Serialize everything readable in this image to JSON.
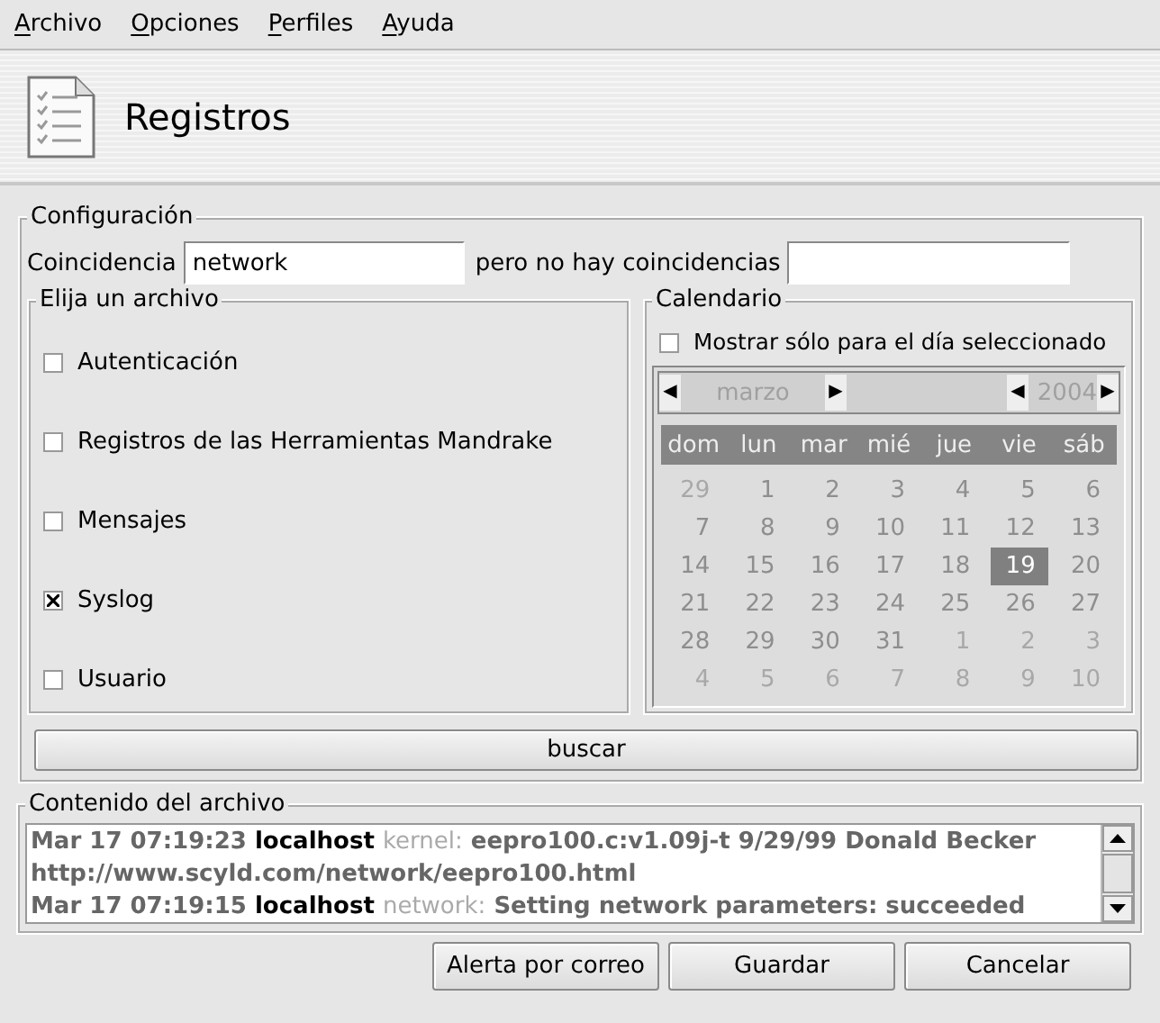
{
  "menu": [
    {
      "label": "Archivo",
      "mnemonic": true
    },
    {
      "label": "Opciones",
      "mnemonic": true
    },
    {
      "label": "Perfiles",
      "mnemonic": true
    },
    {
      "label": "Ayuda",
      "mnemonic": true
    }
  ],
  "header": {
    "title": "Registros"
  },
  "config": {
    "title": "Configuración",
    "match_label": "Coincidencia",
    "match_value": "network",
    "nomatch_label": "pero no hay coincidencias"
  },
  "files": {
    "title": "Elija un archivo",
    "items": [
      {
        "label": "Autenticación",
        "checked": false
      },
      {
        "label": "Registros de las Herramientas Mandrake",
        "checked": false
      },
      {
        "label": "Mensajes",
        "checked": false
      },
      {
        "label": "Syslog",
        "checked": true
      },
      {
        "label": "Usuario",
        "checked": false
      }
    ]
  },
  "calendar": {
    "title": "Calendario",
    "only_selected_day": {
      "label": "Mostrar sólo para el día seleccionado",
      "checked": false
    },
    "disabled": true,
    "month": "marzo",
    "year": "2004",
    "prev": "◀",
    "next": "▶",
    "weekdays": [
      "dom",
      "lun",
      "mar",
      "mié",
      "jue",
      "vie",
      "sáb"
    ],
    "days": [
      {
        "day": "29",
        "current_month": false,
        "selected": false
      },
      {
        "day": "1",
        "current_month": true,
        "selected": false
      },
      {
        "day": "2",
        "current_month": true,
        "selected": false
      },
      {
        "day": "3",
        "current_month": true,
        "selected": false
      },
      {
        "day": "4",
        "current_month": true,
        "selected": false
      },
      {
        "day": "5",
        "current_month": true,
        "selected": false
      },
      {
        "day": "6",
        "current_month": true,
        "selected": false
      },
      {
        "day": "7",
        "current_month": true,
        "selected": false
      },
      {
        "day": "8",
        "current_month": true,
        "selected": false
      },
      {
        "day": "9",
        "current_month": true,
        "selected": false
      },
      {
        "day": "10",
        "current_month": true,
        "selected": false
      },
      {
        "day": "11",
        "current_month": true,
        "selected": false
      },
      {
        "day": "12",
        "current_month": true,
        "selected": false
      },
      {
        "day": "13",
        "current_month": true,
        "selected": false
      },
      {
        "day": "14",
        "current_month": true,
        "selected": false
      },
      {
        "day": "15",
        "current_month": true,
        "selected": false
      },
      {
        "day": "16",
        "current_month": true,
        "selected": false
      },
      {
        "day": "17",
        "current_month": true,
        "selected": false
      },
      {
        "day": "18",
        "current_month": true,
        "selected": false
      },
      {
        "day": "19",
        "current_month": true,
        "selected": true
      },
      {
        "day": "20",
        "current_month": true,
        "selected": false
      },
      {
        "day": "21",
        "current_month": true,
        "selected": false
      },
      {
        "day": "22",
        "current_month": true,
        "selected": false
      },
      {
        "day": "23",
        "current_month": true,
        "selected": false
      },
      {
        "day": "24",
        "current_month": true,
        "selected": false
      },
      {
        "day": "25",
        "current_month": true,
        "selected": false
      },
      {
        "day": "26",
        "current_month": true,
        "selected": false
      },
      {
        "day": "27",
        "current_month": true,
        "selected": false
      },
      {
        "day": "28",
        "current_month": true,
        "selected": false
      },
      {
        "day": "29",
        "current_month": true,
        "selected": false
      },
      {
        "day": "30",
        "current_month": true,
        "selected": false
      },
      {
        "day": "31",
        "current_month": true,
        "selected": false
      },
      {
        "day": "1",
        "current_month": false,
        "selected": false
      },
      {
        "day": "2",
        "current_month": false,
        "selected": false
      },
      {
        "day": "3",
        "current_month": false,
        "selected": false
      },
      {
        "day": "4",
        "current_month": false,
        "selected": false
      },
      {
        "day": "5",
        "current_month": false,
        "selected": false
      },
      {
        "day": "6",
        "current_month": false,
        "selected": false
      },
      {
        "day": "7",
        "current_month": false,
        "selected": false
      },
      {
        "day": "8",
        "current_month": false,
        "selected": false
      },
      {
        "day": "9",
        "current_month": false,
        "selected": false
      },
      {
        "day": "10",
        "current_month": false,
        "selected": false
      }
    ]
  },
  "search_button": "buscar",
  "content": {
    "title": "Contenido del archivo",
    "lines": [
      [
        {
          "kind": "date",
          "text": "Mar 17 07:19:23"
        },
        {
          "kind": "host",
          "text": "localhost"
        },
        {
          "kind": "facility",
          "text": "kernel:"
        },
        {
          "kind": "message",
          "text": "eepro100.c:v1.09j-t 9/29/99 Donald Becker"
        }
      ],
      [
        {
          "kind": "message",
          "text": "http://www.scyld.com/network/eepro100.html"
        }
      ],
      [
        {
          "kind": "date",
          "text": "Mar 17 07:19:15"
        },
        {
          "kind": "host",
          "text": "localhost"
        },
        {
          "kind": "facility",
          "text": "network:"
        },
        {
          "kind": "message",
          "text": "Setting network parameters: succeeded"
        }
      ]
    ]
  },
  "buttons": [
    "Alerta por correo",
    "Guardar",
    "Cancelar"
  ]
}
